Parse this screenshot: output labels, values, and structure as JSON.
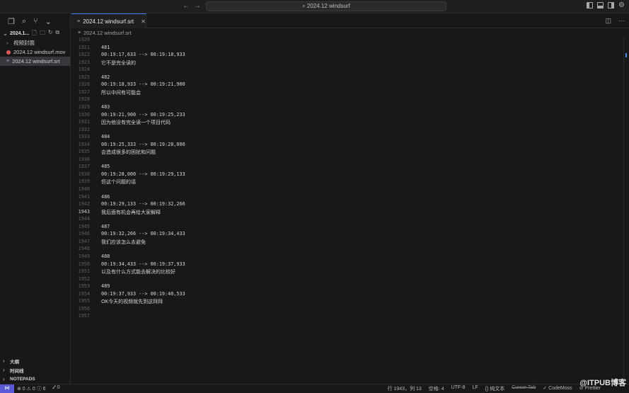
{
  "titlebar": {
    "back_icon": "←",
    "forward_icon": "→",
    "command_center": "2024.12 windsurf"
  },
  "sidebar": {
    "top_icons": [
      "files-icon",
      "search-icon",
      "source-control-icon",
      "chevron-down-icon"
    ],
    "workspace_title": "2024.1...",
    "items": [
      {
        "label": "视频封面",
        "type": "folder"
      },
      {
        "label": "2024.12 windsurf.mov",
        "type": "mov"
      },
      {
        "label": "2024.12 windsurf.srt",
        "type": "srt",
        "selected": true
      }
    ],
    "bottom": [
      {
        "label": "大纲"
      },
      {
        "label": "时间线"
      },
      {
        "label": "NOTEPADS"
      }
    ]
  },
  "editor": {
    "tab_label": "2024.12 windsurf.srt",
    "breadcrumb": "2024.12 windsurf.srt",
    "lines": [
      {
        "n": "1920",
        "t": "",
        "cn": false
      },
      {
        "n": "1921",
        "t": "481",
        "cn": false
      },
      {
        "n": "1922",
        "t": "00:19:17,633 --> 00:19:18,933",
        "cn": false
      },
      {
        "n": "1923",
        "t": "它不是完全读的",
        "cn": true
      },
      {
        "n": "1924",
        "t": "",
        "cn": false
      },
      {
        "n": "1925",
        "t": "482",
        "cn": false
      },
      {
        "n": "1926",
        "t": "00:19:18,933 --> 00:19:21,900",
        "cn": false
      },
      {
        "n": "1927",
        "t": "所以中间有可能会",
        "cn": true
      },
      {
        "n": "1928",
        "t": "",
        "cn": false
      },
      {
        "n": "1929",
        "t": "483",
        "cn": false
      },
      {
        "n": "1930",
        "t": "00:19:21,900 --> 00:19:25,233",
        "cn": false
      },
      {
        "n": "1931",
        "t": "因为他没有完全读一个项目代码",
        "cn": true
      },
      {
        "n": "1932",
        "t": "",
        "cn": false
      },
      {
        "n": "1933",
        "t": "484",
        "cn": false
      },
      {
        "n": "1934",
        "t": "00:19:25,333 --> 00:19:28,000",
        "cn": false
      },
      {
        "n": "1935",
        "t": "会造成很多的困扰和问题",
        "cn": true
      },
      {
        "n": "1936",
        "t": "",
        "cn": false
      },
      {
        "n": "1937",
        "t": "485",
        "cn": false
      },
      {
        "n": "1938",
        "t": "00:19:28,000 --> 00:19:29,133",
        "cn": false
      },
      {
        "n": "1939",
        "t": "但这个问题的话",
        "cn": true
      },
      {
        "n": "1940",
        "t": "",
        "cn": false
      },
      {
        "n": "1941",
        "t": "486",
        "cn": false
      },
      {
        "n": "1942",
        "t": "00:19:29,133 --> 00:19:32,266",
        "cn": false
      },
      {
        "n": "1943",
        "t": "我后面有机会再给大家解释",
        "cn": true,
        "current": true
      },
      {
        "n": "1944",
        "t": "",
        "cn": false
      },
      {
        "n": "1945",
        "t": "487",
        "cn": false
      },
      {
        "n": "1946",
        "t": "00:19:32,266 --> 00:19:34,433",
        "cn": false
      },
      {
        "n": "1947",
        "t": "我们应该怎么去避免",
        "cn": true
      },
      {
        "n": "1948",
        "t": "",
        "cn": false
      },
      {
        "n": "1949",
        "t": "488",
        "cn": false
      },
      {
        "n": "1950",
        "t": "00:19:34,433 --> 00:19:37,933",
        "cn": false
      },
      {
        "n": "1951",
        "t": "以及有什么方式能去解决的比较好",
        "cn": true
      },
      {
        "n": "1952",
        "t": "",
        "cn": false
      },
      {
        "n": "1953",
        "t": "489",
        "cn": false
      },
      {
        "n": "1954",
        "t": "00:19:37,933 --> 00:19:40,533",
        "cn": false
      },
      {
        "n": "1955",
        "t": "OK今天的视频就先到这拜拜",
        "cn": true
      },
      {
        "n": "1956",
        "t": "",
        "cn": false
      },
      {
        "n": "1957",
        "t": "",
        "cn": false
      }
    ]
  },
  "statusbar": {
    "remote": "⋈",
    "problems": "⊗ 0 ⚠ 0 ⓘ 6",
    "ports": "⑇ 0",
    "position": "行 1943，列 13",
    "spaces": "空格: 4",
    "encoding": "UTF-8",
    "eol": "LF",
    "language": "{} 纯文本",
    "cursor_tab": "Cursor Tab",
    "codemoss": "✓ CodeMoss",
    "prettier": "⊘ Prettier"
  },
  "watermark": "@ITPUB博客",
  "colors": {
    "accent": "#3b82f6",
    "remote_bg": "#5b5ad6",
    "mov_dot": "#e05a5a"
  }
}
